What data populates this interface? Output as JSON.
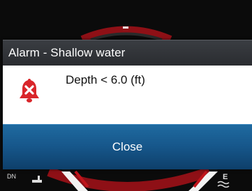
{
  "dialog": {
    "title": "Alarm - Shallow water",
    "message": "Depth < 6.0 (ft)",
    "icon": "alarm-bell-icon",
    "close_label": "Close"
  },
  "background": {
    "left_label": "DN",
    "right_label": "E"
  },
  "colors": {
    "header_bg": "#2f3236",
    "button_bg": "#16568a",
    "alarm_red": "#d9262b",
    "gauge_red": "#b0141b"
  }
}
